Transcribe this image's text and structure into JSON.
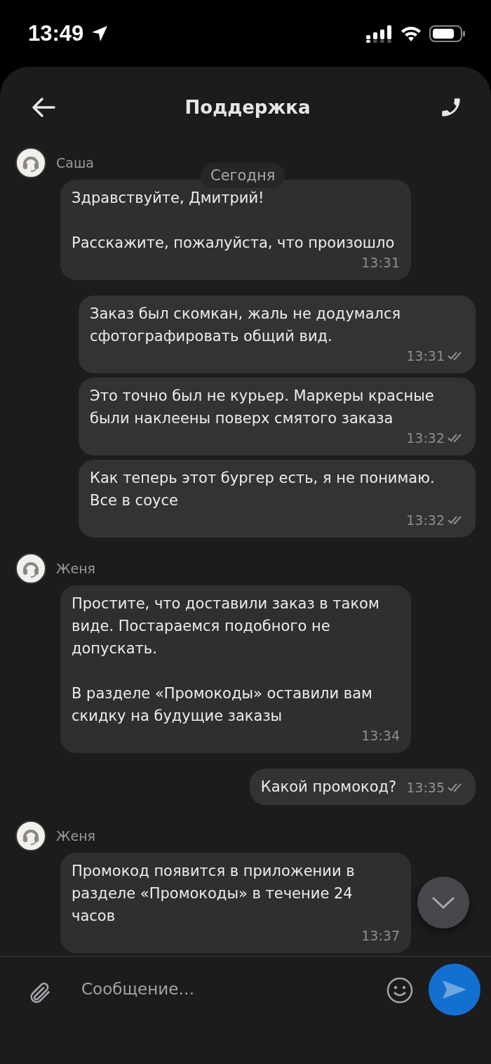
{
  "status_bar": {
    "time": "13:49"
  },
  "header": {
    "title": "Поддержка"
  },
  "date_badge": "Сегодня",
  "groups": [
    {
      "kind": "incoming",
      "author": "Саша",
      "bubbles": [
        {
          "text": "Здравствуйте, Дмитрий!\n\nРасскажите, пожалуйста, что произошло",
          "time": "13:31"
        }
      ]
    },
    {
      "kind": "outgoing",
      "bubbles": [
        {
          "text": "Заказ был скомкан, жаль не додумался сфотографировать общий вид.",
          "time": "13:31",
          "read": true
        },
        {
          "text": "Это точно был не курьер. Маркеры красные были наклеены поверх смятого заказа",
          "time": "13:32",
          "read": true
        },
        {
          "text": "Как теперь этот бургер есть, я не понимаю. Все в соусе",
          "time": "13:32",
          "read": true
        }
      ]
    },
    {
      "kind": "incoming",
      "author": "Женя",
      "bubbles": [
        {
          "text": "Простите, что доставили заказ в таком виде. Постараемся подобного не допускать.\n\nВ разделе «Промокоды» оставили вам скидку на будущие заказы",
          "time": "13:34"
        }
      ]
    },
    {
      "kind": "outgoing",
      "bubbles": [
        {
          "text": "Какой промокод?",
          "time": "13:35",
          "read": true
        }
      ]
    },
    {
      "kind": "incoming",
      "author": "Женя",
      "bubbles": [
        {
          "text": "Промокод появится в приложении в разделе «Промокоды» в течение 24 часов",
          "time": "13:37"
        }
      ]
    }
  ],
  "composer": {
    "placeholder": "Сообщение…"
  }
}
